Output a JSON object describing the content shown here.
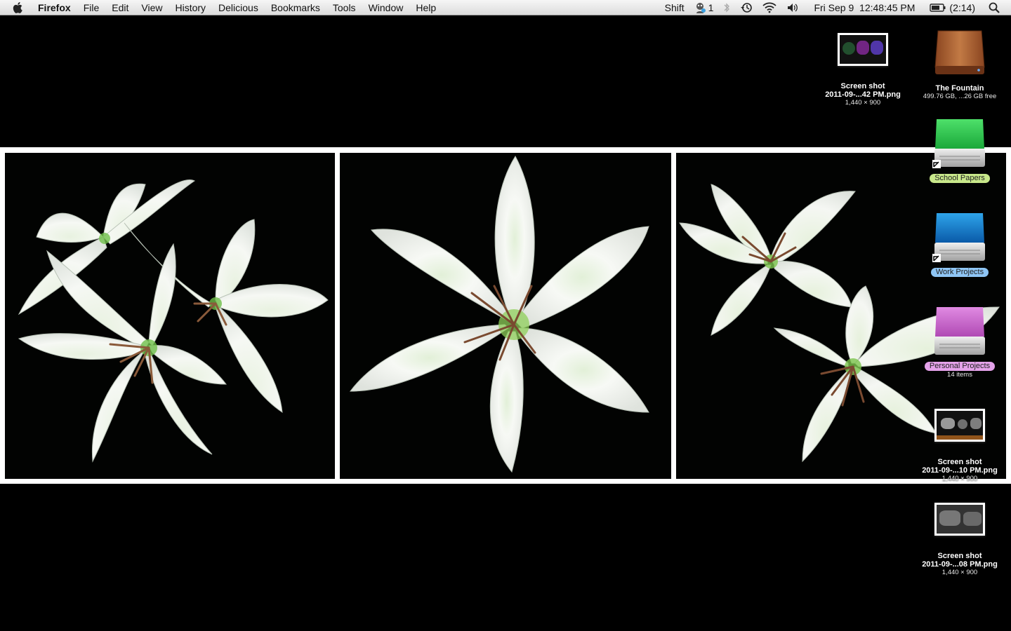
{
  "menubar": {
    "app_name": "Firefox",
    "menus": [
      "File",
      "Edit",
      "View",
      "History",
      "Delicious",
      "Bookmarks",
      "Tools",
      "Window",
      "Help"
    ],
    "status": {
      "shift_label": "Shift",
      "user_count": "1",
      "datetime": "Fri Sep 9  12:48:45 PM",
      "battery": "(2:14)"
    },
    "icons": [
      "apple-icon",
      "user-icon",
      "bluetooth-icon",
      "time-machine-icon",
      "wifi-icon",
      "volume-icon",
      "battery-icon",
      "spotlight-icon"
    ]
  },
  "desktop": {
    "icons": [
      {
        "kind": "screenshot",
        "name": "Screen shot",
        "name2": "2011-09-...42 PM.png",
        "info": "1,440 × 900"
      },
      {
        "kind": "drive",
        "name": "The Fountain",
        "info": "499.76 GB, ...26 GB free",
        "color": "#a0582a"
      },
      {
        "kind": "alias-drive",
        "name": "School Papers",
        "label_color": "#c8e88a",
        "color": "#22c84a"
      },
      {
        "kind": "alias-drive",
        "name": "Work Projects",
        "label_color": "#8fc6f5",
        "color": "#1a7fd0"
      },
      {
        "kind": "drive",
        "name": "Personal Projects",
        "info": "14 items",
        "label_color": "#e4a2ea",
        "color": "#c462c8"
      },
      {
        "kind": "screenshot",
        "name": "Screen shot",
        "name2": "2011-09-...10 PM.png",
        "info": "1,440 × 900"
      },
      {
        "kind": "screenshot",
        "name": "Screen shot",
        "name2": "2011-09-...08 PM.png",
        "info": "1,440 × 900"
      }
    ]
  }
}
